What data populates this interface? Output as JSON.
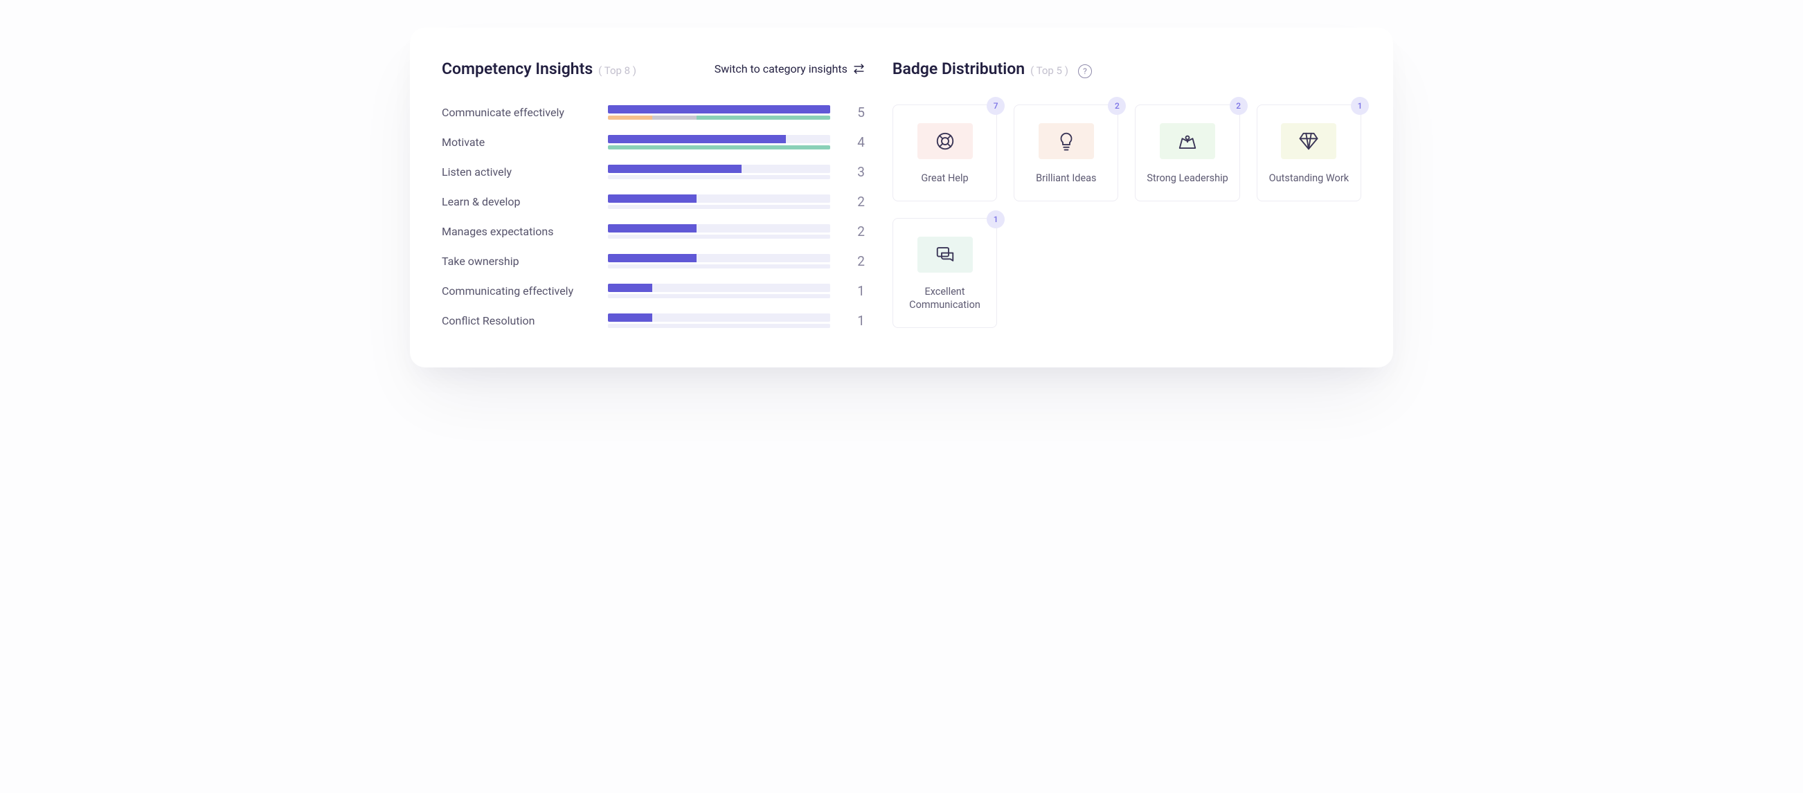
{
  "competency": {
    "title": "Competency Insights",
    "subtitle": "( Top 8 )",
    "switch_label": "Switch to category insights",
    "max": 5,
    "items": [
      {
        "label": "Communicate effectively",
        "value": 5,
        "sub_segments": [
          {
            "color": "orange",
            "pct": 20
          },
          {
            "color": "grey",
            "pct": 20
          },
          {
            "color": "teal",
            "pct": 60
          }
        ]
      },
      {
        "label": "Motivate",
        "value": 4,
        "sub_segments": [
          {
            "color": "teal",
            "pct": 100
          }
        ]
      },
      {
        "label": "Listen actively",
        "value": 3,
        "sub_segments": []
      },
      {
        "label": "Learn & develop",
        "value": 2,
        "sub_segments": []
      },
      {
        "label": "Manages expectations",
        "value": 2,
        "sub_segments": []
      },
      {
        "label": "Take ownership",
        "value": 2,
        "sub_segments": []
      },
      {
        "label": "Communicating effectively",
        "value": 1,
        "sub_segments": []
      },
      {
        "label": "Conflict Resolution",
        "value": 1,
        "sub_segments": []
      }
    ]
  },
  "badges": {
    "title": "Badge Distribution",
    "subtitle": "( Top 5 )",
    "items": [
      {
        "label": "Great Help",
        "count": 7,
        "icon": "lifebuoy",
        "tint": "red"
      },
      {
        "label": "Brilliant Ideas",
        "count": 2,
        "icon": "bulb",
        "tint": "peach"
      },
      {
        "label": "Strong Leadership",
        "count": 2,
        "icon": "map-pin",
        "tint": "green"
      },
      {
        "label": "Outstanding Work",
        "count": 1,
        "icon": "diamond",
        "tint": "lemon"
      },
      {
        "label": "Excellent Communication",
        "count": 1,
        "icon": "chat",
        "tint": "mint"
      }
    ]
  },
  "chart_data": {
    "type": "bar",
    "title": "Competency Insights ( Top 8 )",
    "xlabel": "",
    "ylabel": "",
    "ylim": [
      0,
      5
    ],
    "categories": [
      "Communicate effectively",
      "Motivate",
      "Listen actively",
      "Learn & develop",
      "Manages expectations",
      "Take ownership",
      "Communicating effectively",
      "Conflict Resolution"
    ],
    "values": [
      5,
      4,
      3,
      2,
      2,
      2,
      1,
      1
    ]
  }
}
